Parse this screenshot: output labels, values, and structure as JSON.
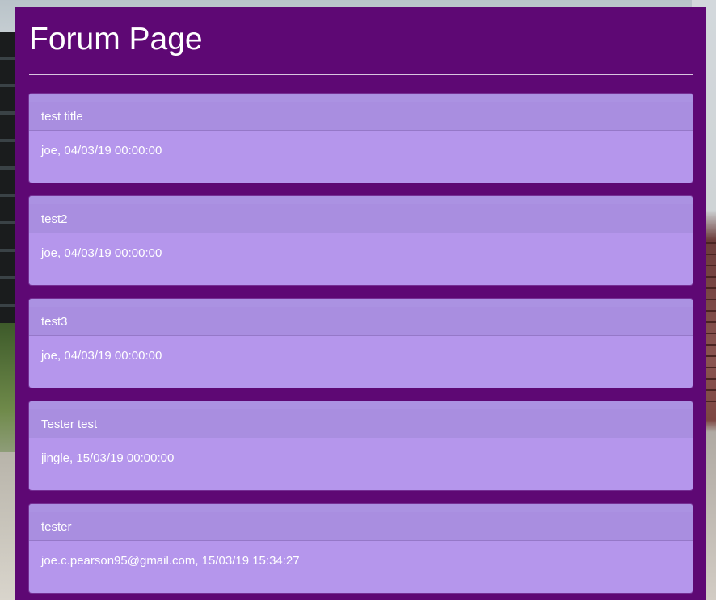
{
  "page": {
    "title": "Forum Page"
  },
  "colors": {
    "panel": "#5e0874",
    "card": "#b596ec",
    "card_header": "#a98ee0",
    "text": "#ffffff"
  },
  "posts": [
    {
      "title": "test title",
      "meta": "joe, 04/03/19 00:00:00"
    },
    {
      "title": "test2",
      "meta": "joe, 04/03/19 00:00:00"
    },
    {
      "title": "test3",
      "meta": "joe, 04/03/19 00:00:00"
    },
    {
      "title": "Tester test",
      "meta": "jingle, 15/03/19 00:00:00"
    },
    {
      "title": "tester",
      "meta": "joe.c.pearson95@gmail.com, 15/03/19 15:34:27"
    }
  ]
}
